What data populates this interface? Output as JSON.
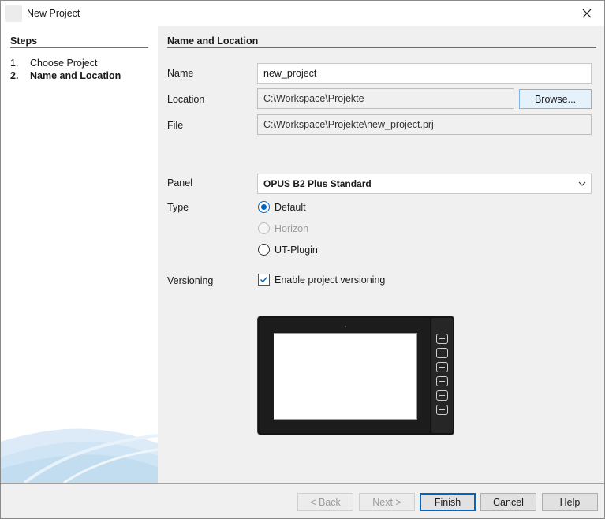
{
  "window": {
    "title": "New Project"
  },
  "steps": {
    "heading": "Steps",
    "items": [
      {
        "num": "1.",
        "label": "Choose Project",
        "current": false
      },
      {
        "num": "2.",
        "label": "Name and Location",
        "current": true
      }
    ]
  },
  "section": {
    "heading": "Name and Location"
  },
  "form": {
    "name": {
      "label": "Name",
      "value": "new_project"
    },
    "location": {
      "label": "Location",
      "value": "C:\\Workspace\\Projekte",
      "browse_label": "Browse..."
    },
    "file": {
      "label": "File",
      "value": "C:\\Workspace\\Projekte\\new_project.prj"
    },
    "panel": {
      "label": "Panel",
      "selected": "OPUS B2 Plus Standard"
    },
    "type": {
      "label": "Type",
      "options": [
        {
          "label": "Default",
          "checked": true,
          "disabled": false
        },
        {
          "label": "Horizon",
          "checked": false,
          "disabled": true
        },
        {
          "label": "UT-Plugin",
          "checked": false,
          "disabled": false
        }
      ]
    },
    "versioning": {
      "label": "Versioning",
      "checkbox_label": "Enable project versioning",
      "checked": true
    }
  },
  "footer": {
    "back": "< Back",
    "next": "Next >",
    "finish": "Finish",
    "cancel": "Cancel",
    "help": "Help"
  },
  "colors": {
    "accent": "#0067c0",
    "dialog_bg": "#f0f0f0",
    "panel_frame": "#141414"
  },
  "icons": {
    "close": "close-icon",
    "dropdown": "chevron-down-icon",
    "check": "check-icon",
    "app": "app-icon"
  }
}
